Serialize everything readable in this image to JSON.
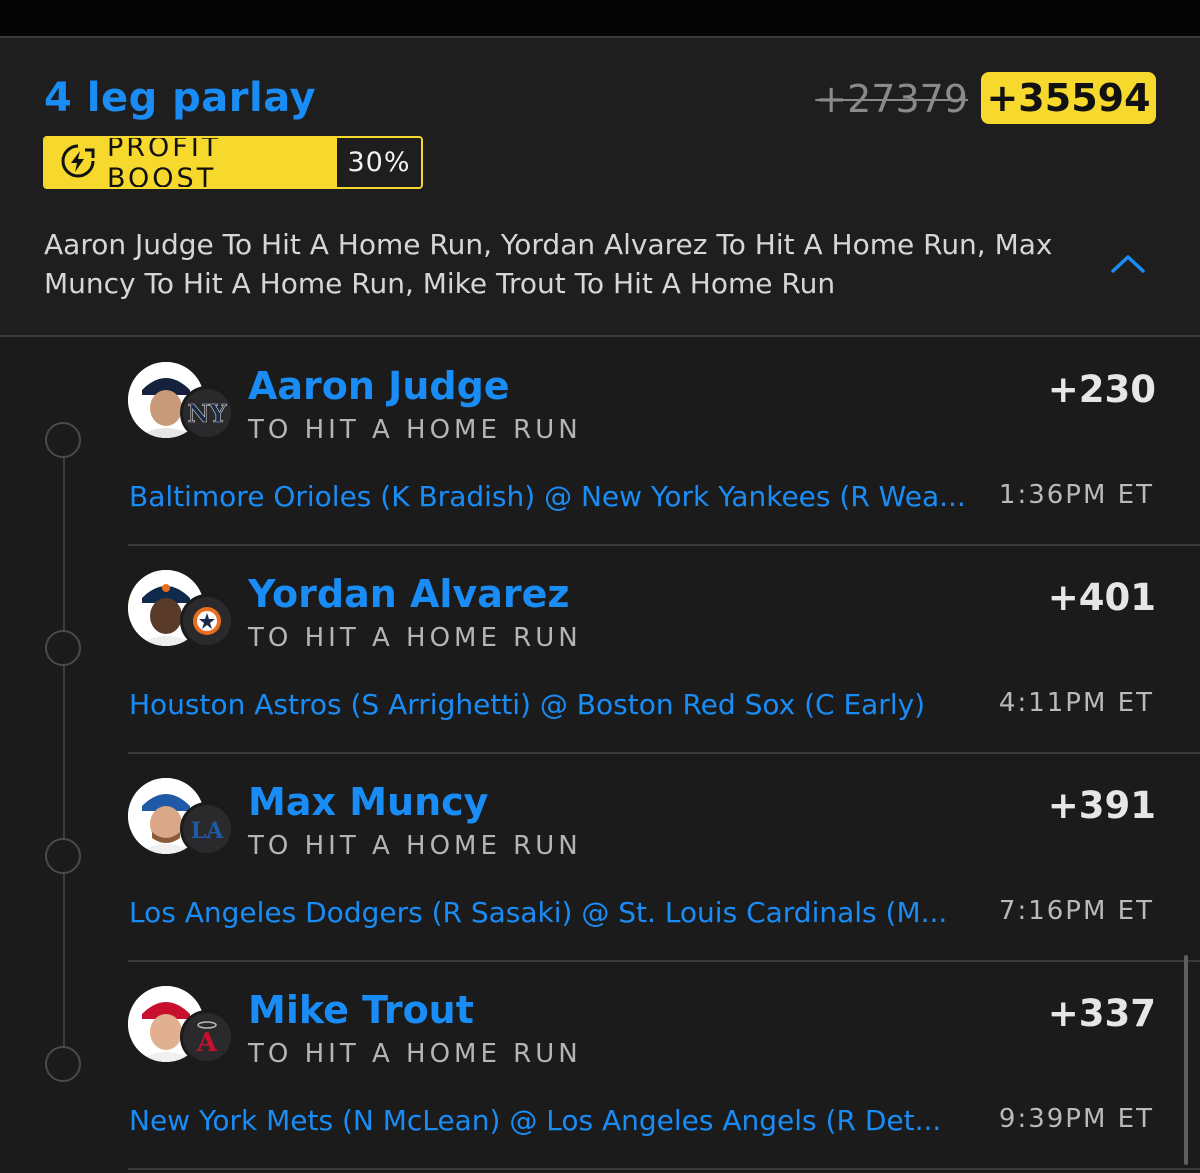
{
  "parlay": {
    "title": "4 leg parlay",
    "old_odds": "+27379",
    "new_odds": "+35594",
    "boost_label": "PROFIT BOOST",
    "boost_pct": "30%",
    "summary": "Aaron Judge To Hit A Home Run, Yordan Alvarez To Hit A Home Run, Max Muncy To Hit A Home Run, Mike Trout To Hit A Home Run"
  },
  "colors": {
    "accent": "#1a8cf5",
    "boost": "#f7d82c",
    "background": "#1b1b1c"
  },
  "legs": [
    {
      "player": "Aaron Judge",
      "market": "TO HIT A HOME RUN",
      "odds": "+230",
      "matchup": "Baltimore Orioles (K Bradish) @ New York Yankees (R Wea...",
      "time": "1:36PM ET",
      "team_icon": "yankees-logo"
    },
    {
      "player": "Yordan Alvarez",
      "market": "TO HIT A HOME RUN",
      "odds": "+401",
      "matchup": "Houston Astros (S Arrighetti) @ Boston Red Sox (C Early)",
      "time": "4:11PM ET",
      "team_icon": "astros-logo"
    },
    {
      "player": "Max Muncy",
      "market": "TO HIT A HOME RUN",
      "odds": "+391",
      "matchup": "Los Angeles Dodgers (R Sasaki) @ St. Louis Cardinals (M...",
      "time": "7:16PM ET",
      "team_icon": "dodgers-logo"
    },
    {
      "player": "Mike Trout",
      "market": "TO HIT A HOME RUN",
      "odds": "+337",
      "matchup": "New York Mets (N McLean) @ Los Angeles Angels (R Det...",
      "time": "9:39PM ET",
      "team_icon": "angels-logo"
    }
  ]
}
